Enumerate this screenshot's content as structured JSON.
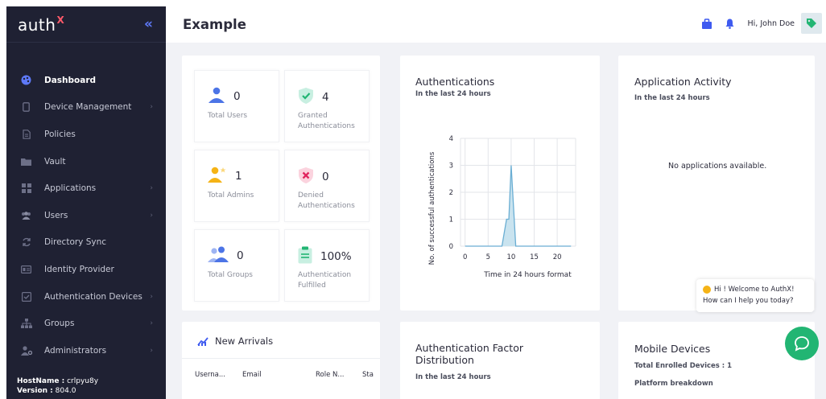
{
  "sidebar": {
    "logo": "auth",
    "logo_sup": "X",
    "collapse_glyph": "«",
    "items": [
      {
        "label": "Dashboard",
        "icon": "palette-icon",
        "active": true,
        "has_chevron": false
      },
      {
        "label": "Device Management",
        "icon": "mobile-icon",
        "active": false,
        "has_chevron": true
      },
      {
        "label": "Policies",
        "icon": "document-icon",
        "active": false,
        "has_chevron": false
      },
      {
        "label": "Vault",
        "icon": "folder-icon",
        "active": false,
        "has_chevron": false
      },
      {
        "label": "Applications",
        "icon": "grid-icon",
        "active": false,
        "has_chevron": true
      },
      {
        "label": "Users",
        "icon": "users-icon",
        "active": false,
        "has_chevron": true
      },
      {
        "label": "Directory Sync",
        "icon": "sync-icon",
        "active": false,
        "has_chevron": false
      },
      {
        "label": "Identity Provider",
        "icon": "id-card-icon",
        "active": false,
        "has_chevron": false
      },
      {
        "label": "Authentication Devices",
        "icon": "check-square-icon",
        "active": false,
        "has_chevron": true
      },
      {
        "label": "Groups",
        "icon": "sitemap-icon",
        "active": false,
        "has_chevron": true
      },
      {
        "label": "Administrators",
        "icon": "user-cog-icon",
        "active": false,
        "has_chevron": true
      }
    ],
    "footer": {
      "hostname_label": "HostName :",
      "hostname_value": "crlpyu8y",
      "version_label": "Version :",
      "version_value": "804.0"
    }
  },
  "header": {
    "title": "Example",
    "greeting": "Hi, John Doe",
    "icons": [
      "briefcase-icon",
      "bell-icon",
      "tag-icon"
    ]
  },
  "stats": [
    {
      "value": "0",
      "label": "Total Users",
      "icon": "user-icon"
    },
    {
      "value": "4",
      "label": "Granted Authentications",
      "icon": "shield-check-icon"
    },
    {
      "value": "1",
      "label": "Total Admins",
      "icon": "admin-icon"
    },
    {
      "value": "0",
      "label": "Denied Authentications",
      "icon": "shield-x-icon"
    },
    {
      "value": "0",
      "label": "Total Groups",
      "icon": "group-icon"
    },
    {
      "value": "100%",
      "label": "Authentication Fulfilled",
      "icon": "clipboard-icon"
    }
  ],
  "auth_card": {
    "title": "Authentications",
    "subtitle": "In the last 24 hours"
  },
  "activity_card": {
    "title": "Application Activity",
    "subtitle": "In the last 24 hours",
    "empty": "No applications available."
  },
  "arrivals_card": {
    "title": "New Arrivals",
    "columns": [
      "Userna...",
      "Email",
      "Role N...",
      "Sta"
    ]
  },
  "factor_card": {
    "title_line1": "Authentication Factor",
    "title_line2": "Distribution",
    "subtitle": "In the last 24 hours"
  },
  "mobile_card": {
    "title": "Mobile Devices",
    "enrolled": "Total Enrolled Devices : 1",
    "platform": "Platform breakdown"
  },
  "chat": {
    "line1": "Hi ! Welcome to AuthX!",
    "line2": "How can I help you today?"
  },
  "colors": {
    "sidebar_bg": "#1f2133",
    "accent_blue": "#5e79f7",
    "chat_green": "#22b573",
    "chart_fill": "#c9e3ef"
  },
  "chart_data": {
    "type": "area",
    "xlabel": "Time in 24 hours format",
    "ylabel": "No. of successful authentications",
    "xlim": [
      -1,
      24
    ],
    "ylim": [
      0,
      4
    ],
    "x_ticks": [
      0,
      5,
      10,
      15,
      20
    ],
    "y_ticks": [
      0,
      1,
      2,
      3,
      4
    ],
    "x": [
      0,
      1,
      2,
      3,
      4,
      5,
      6,
      7,
      8,
      9,
      9.5,
      10,
      11,
      12,
      13,
      14,
      15,
      16,
      17,
      18,
      19,
      20,
      21,
      22,
      23
    ],
    "values": [
      0,
      0,
      0,
      0,
      0,
      0,
      0,
      0,
      0,
      1,
      1,
      3,
      0,
      0,
      0,
      0,
      0,
      0,
      0,
      0,
      0,
      0,
      0,
      0,
      0
    ],
    "grid": true
  }
}
